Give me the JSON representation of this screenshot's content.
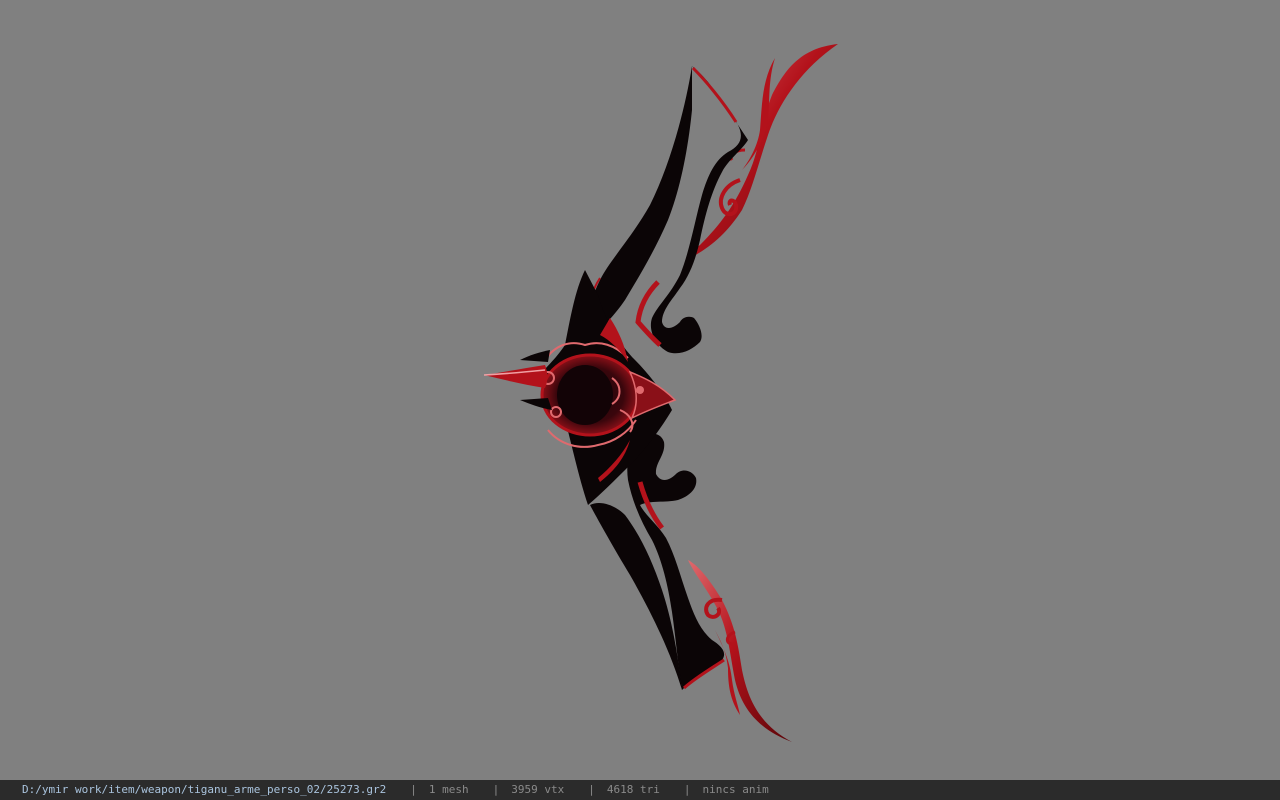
{
  "viewport": {
    "background_color": "#808080",
    "model_name": "bow-model",
    "model_colors": {
      "body": "#0b0506",
      "accent": "#b3121b",
      "highlight": "#e06a6e"
    }
  },
  "status_bar": {
    "file_path": "D:/ymir work/item/weapon/tiganu_arme_perso_02/25273.gr2",
    "separator": "|",
    "mesh": "1 mesh",
    "vertices": "3959 vtx",
    "triangles": "4618 tri",
    "anim": "nincs anim",
    "path_color": "#a9c3dd",
    "text_color": "#8a8a8a",
    "bar_color": "#2b2b2b"
  }
}
